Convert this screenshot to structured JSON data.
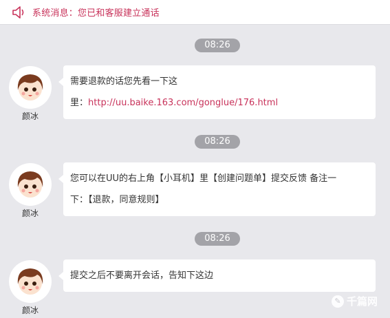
{
  "header": {
    "notice": "系统消息：您已和客服建立通话",
    "accent_color": "#c8325a"
  },
  "messages": [
    {
      "time": "08:26",
      "sender": "颜冰",
      "line1": "需要退款的话您先看一下这",
      "line2_prefix": "里：",
      "line2_link": "http://uu.baike.163.com/gonglue/176.html"
    },
    {
      "time": "08:26",
      "sender": "颜冰",
      "line1": "您可以在UU的右上角【小耳机】里【创建问题单】提交反馈 备注一",
      "line2": "下：【退款，同意规则】"
    },
    {
      "time": "08:26",
      "sender": "颜冰",
      "line1": "提交之后不要离开会话，告知下这边"
    }
  ],
  "watermark": {
    "text": "千篇网",
    "icon": "watermark-logo-icon"
  }
}
